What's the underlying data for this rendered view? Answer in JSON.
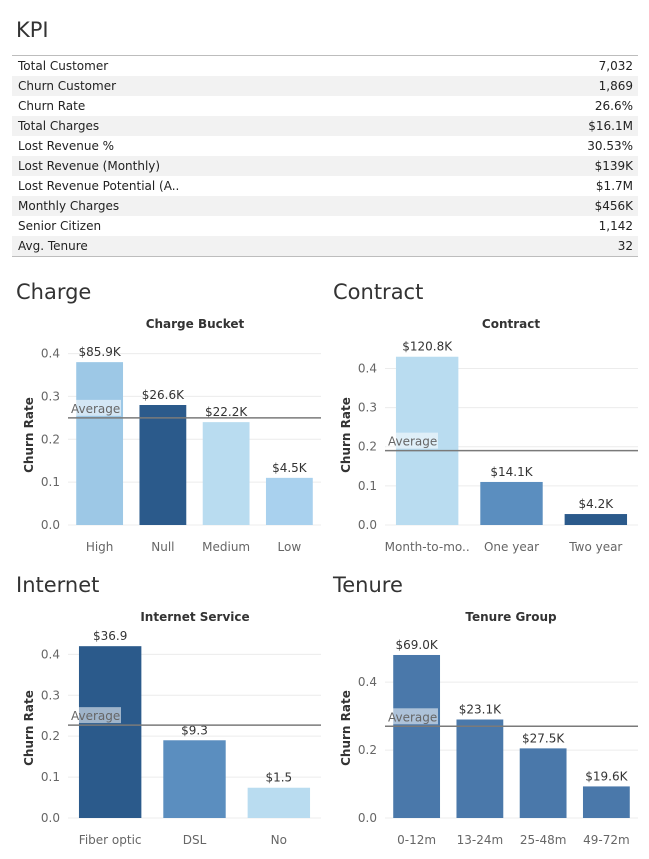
{
  "kpi": {
    "title": "KPI",
    "rows": [
      {
        "label": "Total Customer",
        "value": "7,032"
      },
      {
        "label": "Churn Customer",
        "value": "1,869"
      },
      {
        "label": "Churn Rate",
        "value": "26.6%"
      },
      {
        "label": "Total Charges",
        "value": "$16.1M"
      },
      {
        "label": "Lost Revenue %",
        "value": "30.53%"
      },
      {
        "label": "Lost Revenue (Monthly)",
        "value": "$139K"
      },
      {
        "label": "Lost Revenue Potential (A..",
        "value": "$1.7M"
      },
      {
        "label": "Monthly Charges",
        "value": "$456K"
      },
      {
        "label": "Senior Citizen",
        "value": "1,142"
      },
      {
        "label": "Avg. Tenure",
        "value": "32"
      }
    ]
  },
  "sections": {
    "charge": "Charge",
    "contract": "Contract",
    "internet": "Internet",
    "tenure": "Tenure"
  },
  "chart_data": [
    {
      "id": "charge",
      "type": "bar",
      "title": "Charge Bucket",
      "ylabel": "Churn Rate",
      "ylim": [
        0,
        0.42
      ],
      "yticks": [
        "0.0",
        "0.1",
        "0.2",
        "0.3",
        "0.4"
      ],
      "categories": [
        "High",
        "Null",
        "Medium",
        "Low"
      ],
      "values": [
        0.38,
        0.28,
        0.24,
        0.11
      ],
      "labels": [
        "$85.9K",
        "$26.6K",
        "$22.2K",
        "$4.5K"
      ],
      "colors": [
        "#9dc8e6",
        "#2b5a8b",
        "#b9dcf0",
        "#a9d1ee"
      ],
      "reference_line": {
        "label": "Average",
        "value": 0.25
      }
    },
    {
      "id": "contract",
      "type": "bar",
      "title": "Contract",
      "ylabel": "Churn Rate",
      "ylim": [
        0,
        0.46
      ],
      "yticks": [
        "0.0",
        "0.1",
        "0.2",
        "0.3",
        "0.4"
      ],
      "categories": [
        "Month-to-mo..",
        "One year",
        "Two year"
      ],
      "values": [
        0.43,
        0.11,
        0.028
      ],
      "labels": [
        "$120.8K",
        "$14.1K",
        "$4.2K"
      ],
      "colors": [
        "#b9dcf0",
        "#5b8ebf",
        "#2b5a8b"
      ],
      "reference_line": {
        "label": "Average",
        "value": 0.19
      }
    },
    {
      "id": "internet",
      "type": "bar",
      "title": "Internet Service",
      "ylabel": "Churn Rate",
      "ylim": [
        0,
        0.44
      ],
      "yticks": [
        "0.0",
        "0.1",
        "0.2",
        "0.3",
        "0.4"
      ],
      "categories": [
        "Fiber optic",
        "DSL",
        "No"
      ],
      "values": [
        0.42,
        0.19,
        0.074
      ],
      "labels": [
        "$36.9",
        "$9.3",
        "$1.5"
      ],
      "colors": [
        "#2b5a8b",
        "#5b8ebf",
        "#b9dcf0"
      ],
      "reference_line": {
        "label": "Average",
        "value": 0.227
      }
    },
    {
      "id": "tenure",
      "type": "bar",
      "title": "Tenure Group",
      "ylabel": "Churn Rate",
      "ylim": [
        0,
        0.53
      ],
      "yticks": [
        "0.0",
        "0.2",
        "0.4"
      ],
      "categories": [
        "0-12m",
        "13-24m",
        "25-48m",
        "49-72m"
      ],
      "values": [
        0.48,
        0.29,
        0.205,
        0.093
      ],
      "labels": [
        "$69.0K",
        "$23.1K",
        "$27.5K",
        "$19.6K"
      ],
      "colors": [
        "#4a78aa",
        "#4a78aa",
        "#4a78aa",
        "#4a78aa"
      ],
      "reference_line": {
        "label": "Average",
        "value": 0.27
      }
    }
  ]
}
